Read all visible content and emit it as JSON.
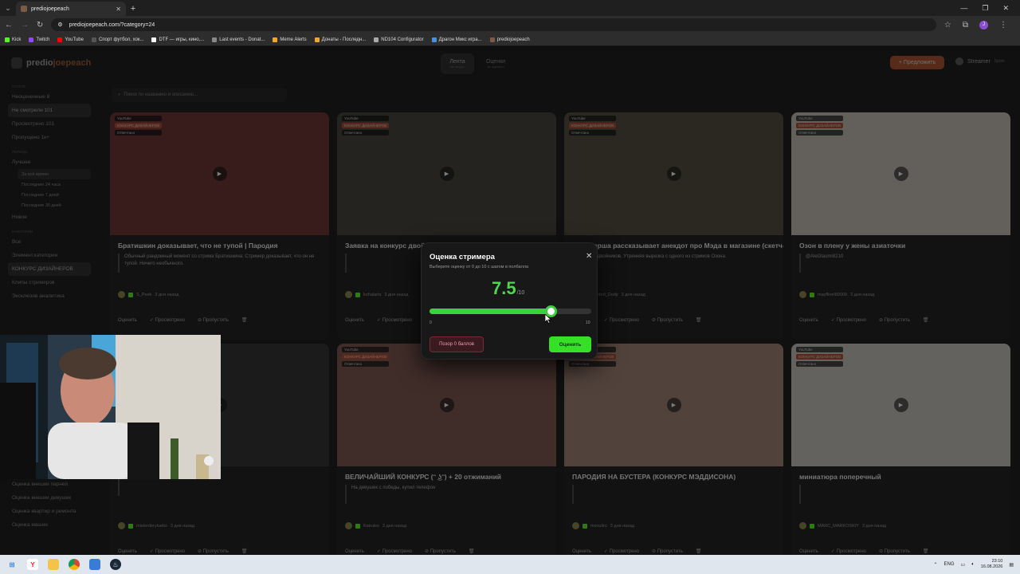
{
  "browser": {
    "tab_title": "prediojoepeach",
    "url": "prediojoepeach.com/?category=24",
    "new_tab_symbol": "+",
    "bookmarks": [
      {
        "label": "Kick",
        "color": "#53fc18"
      },
      {
        "label": "Twitch",
        "color": "#9146ff"
      },
      {
        "label": "YouTube",
        "color": "#ff0000"
      },
      {
        "label": "Спорт футбол, хок...",
        "color": "#555555"
      },
      {
        "label": "DTF — игры, кино,...",
        "color": "#ffffff"
      },
      {
        "label": "Last events - Donat...",
        "color": "#888888"
      },
      {
        "label": "Meme Alerts",
        "color": "#f5a623"
      },
      {
        "label": "Донаты - Последн...",
        "color": "#f5a623"
      },
      {
        "label": "ND104 Configurator",
        "color": "#aaaaaa"
      },
      {
        "label": "Драгон Микс игра...",
        "color": "#4a90e2"
      },
      {
        "label": "prediojoepeach",
        "color": "#7c5a45"
      }
    ],
    "profile_letter": "J"
  },
  "app": {
    "logo_part1": "predio",
    "logo_part2": "joepeach",
    "nav_tabs": [
      {
        "label": "Лента",
        "sub": "все видео"
      },
      {
        "label": "Оценки",
        "sub": "не оценено"
      }
    ],
    "suggest_button": "+ Предложить",
    "username": "Streamer",
    "user_role": "Spotx",
    "search_placeholder": "Поиск по названию и описанию..."
  },
  "sidebar": {
    "status_heading": "Статус",
    "status_items": [
      "Неоцененные 8",
      "Не смотрели 101",
      "Просмотрено 101",
      "Пропущено 1к+"
    ],
    "period_heading": "Период",
    "best_label": "Лучшее",
    "period_items": [
      "За всё время",
      "Последние 24 часа",
      "Последние 7 дней",
      "Последние 30 дней"
    ],
    "new_label": "Новое",
    "category_heading": "Категории",
    "category_items": [
      "Все",
      "Элемент.категории",
      "КОНКУРС ДИЗАЙНЕРОВ",
      "Клипы стримеров",
      "Эксклюзив аналитика"
    ],
    "bottom_items": [
      "Оценка внешки парней",
      "Оценка внешки девушек",
      "Оценка квартир и ремонта",
      "Оценка машин"
    ]
  },
  "cards": [
    {
      "title": "Братишкин доказывает, что не тупой | Пародия",
      "desc": "Обычный рандомный момент со стрима Братишкина: Стример доказывает, что он не тупой. Ничего необычного.",
      "author": "S_Peek",
      "time": "3 дня назад",
      "platform": "YouTube",
      "category": "КОНКУРС ДИЗАЙНЕРОВ",
      "status": "Отвечтано"
    },
    {
      "title": "Заявка на конкурс двойников: Брат Медисона в его прайм",
      "desc": "",
      "author": "kohalarts",
      "time": "3 дня назад",
      "platform": "YouTube",
      "category": "КОНКУРС ДИЗАЙНЕРОВ",
      "status": "Отвечтано"
    },
    {
      "title": "Стримерша рассказывает анекдот про Мэда в магазине (скетч-пародия)",
      "desc": "Конкурс двойников. Утренняя вырезка с одного из стримов Озона.",
      "author": "Wanted_Dody",
      "time": "3 дня назад",
      "platform": "YouTube",
      "category": "КОНКУРС ДИЗАЙНЕРОВ",
      "status": "Отвечтано"
    },
    {
      "title": "Озон в плену у жены азиаточки",
      "desc": "@AleGlaumi8210",
      "author": "mayflinel80009",
      "time": "3 дня назад",
      "platform": "YouTube",
      "category": "КОНКУРС ДИЗАЙНЕРОВ",
      "status": "Отвечтано"
    },
    {
      "title": "",
      "desc": "",
      "author": "misterderyluebs",
      "time": "3 дня назад",
      "platform": "YouTube",
      "category": "КОНКУРС ДИЗАЙНЕРОВ",
      "status": "Отвечтано"
    },
    {
      "title": "ВЕЛИЧАЙШИЙ КОНКУРС (ᵔ ͜ʖᵔ) + 20 отжиманий",
      "desc": "На девушек с победы, купил телефон",
      "author": "Kairules",
      "time": "3 дня назад",
      "platform": "YouTube",
      "category": "КОНКУРС ДИЗАЙНЕРОВ",
      "status": "Отвечтано"
    },
    {
      "title": "ПАРОДИЯ НА БУСТЕРА (КОНКУРС МЭДДИСОНА)",
      "desc": "",
      "author": "mzouliro",
      "time": "3 дня назад",
      "platform": "YouTube",
      "category": "КОНКУРС ДИЗАЙНЕРОВ",
      "status": "Отвечтано"
    },
    {
      "title": "миниатюра поперечный",
      "desc": "",
      "author": "MARC_MARKOSKIY",
      "time": "3 дня назад",
      "platform": "YouTube",
      "category": "КОНКУРС ДИЗАЙНЕРОВ",
      "status": "Отвечтано"
    }
  ],
  "card_actions": {
    "rate": "Оценить",
    "watched": "Просмотрено",
    "skip": "Пропустить"
  },
  "modal": {
    "title": "Оценка стримера",
    "subtitle": "Выберите оценку от 0 до 10 с шагом в полбалла",
    "score": "7.5",
    "score_max": "/10",
    "slider_min": "0",
    "slider_max": "10",
    "slider_value": 7.5,
    "shame_button": "Позор 0 баллов",
    "rate_button": "Оценить"
  },
  "taskbar": {
    "lang": "ENG",
    "time": "23:10",
    "date": "16.08.2026"
  }
}
